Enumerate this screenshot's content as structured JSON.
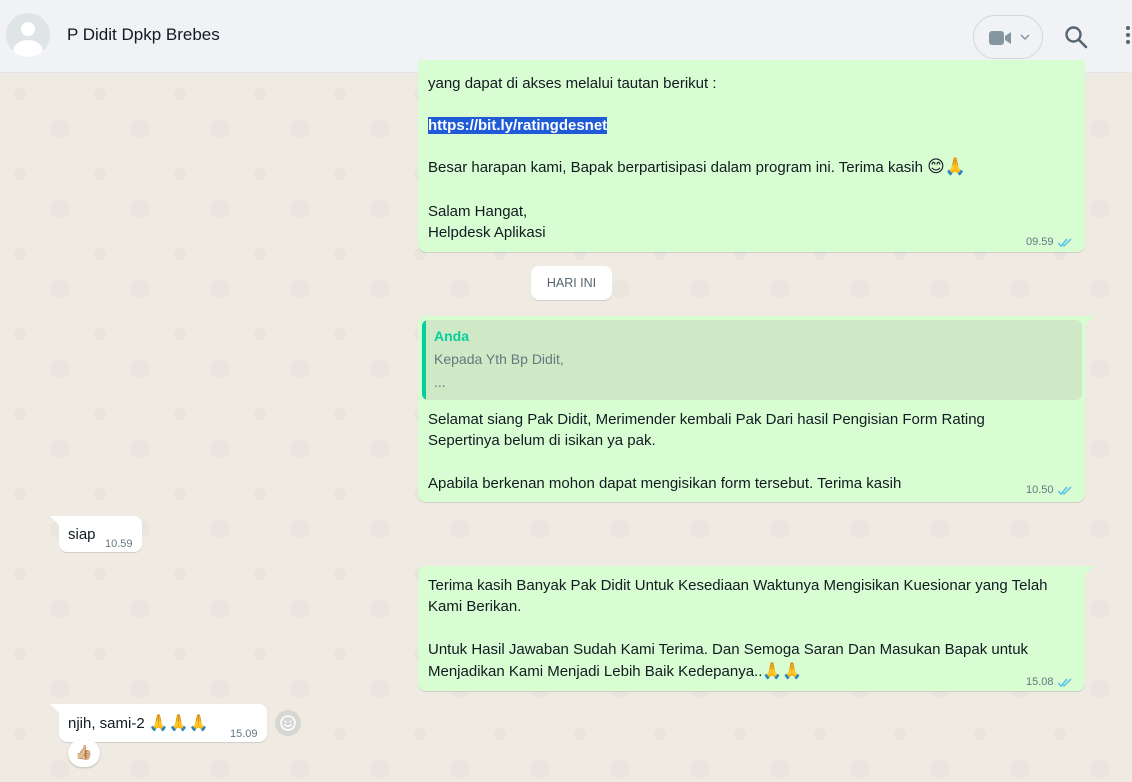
{
  "header": {
    "contact_name": "P Didit Dpkp Brebes",
    "icons": [
      "avatar",
      "video-call-icon",
      "chevron-down-icon",
      "search-icon",
      "menu-icon"
    ]
  },
  "day_chip": "HARI INI",
  "messages": {
    "m1": {
      "lines": [
        "yang dapat di akses melalui tautan berikut :",
        "https://bit.ly/ratingdesnet",
        "Besar harapan kami, Bapak berpartisipasi dalam program ini. Terima kasih",
        "Salam Hangat,",
        "Helpdesk Aplikasi"
      ],
      "time": "09.59"
    },
    "m2": {
      "quote_author": "Anda",
      "quote_line1": "Kepada Yth Bp Didit,",
      "quote_line2": "...",
      "lines": [
        "Selamat siang Pak Didit, Merimender kembali Pak Dari hasil Pengisian Form Rating",
        "Sepertinya belum di isikan ya pak.",
        "Apabila berkenan mohon dapat mengisikan form tersebut. Terima kasih"
      ],
      "time": "10.50"
    },
    "m3": {
      "text": "siap",
      "time": "10.59"
    },
    "m4": {
      "lines": [
        "Terima kasih Banyak Pak Didit Untuk Kesediaan Waktunya Mengisikan Kuesionar yang Telah",
        "Kami Berikan.",
        "Untuk Hasil Jawaban Sudah Kami Terima. Dan Semoga Saran Dan Masukan Bapak untuk",
        "Menjadikan Kami Menjadi Lebih Baik Kedepanya.."
      ],
      "time": "15.08"
    },
    "m5": {
      "text": "njih, sami-2",
      "time": "15.09",
      "reaction": "👍🏼"
    }
  },
  "colors": {
    "outgoing_bubble": "#d9fdd3",
    "incoming_bubble": "#ffffff",
    "read_ticks": "#53bdeb",
    "quote_accent": "#06cf9c",
    "link_highlight": "#1f5bd6"
  }
}
